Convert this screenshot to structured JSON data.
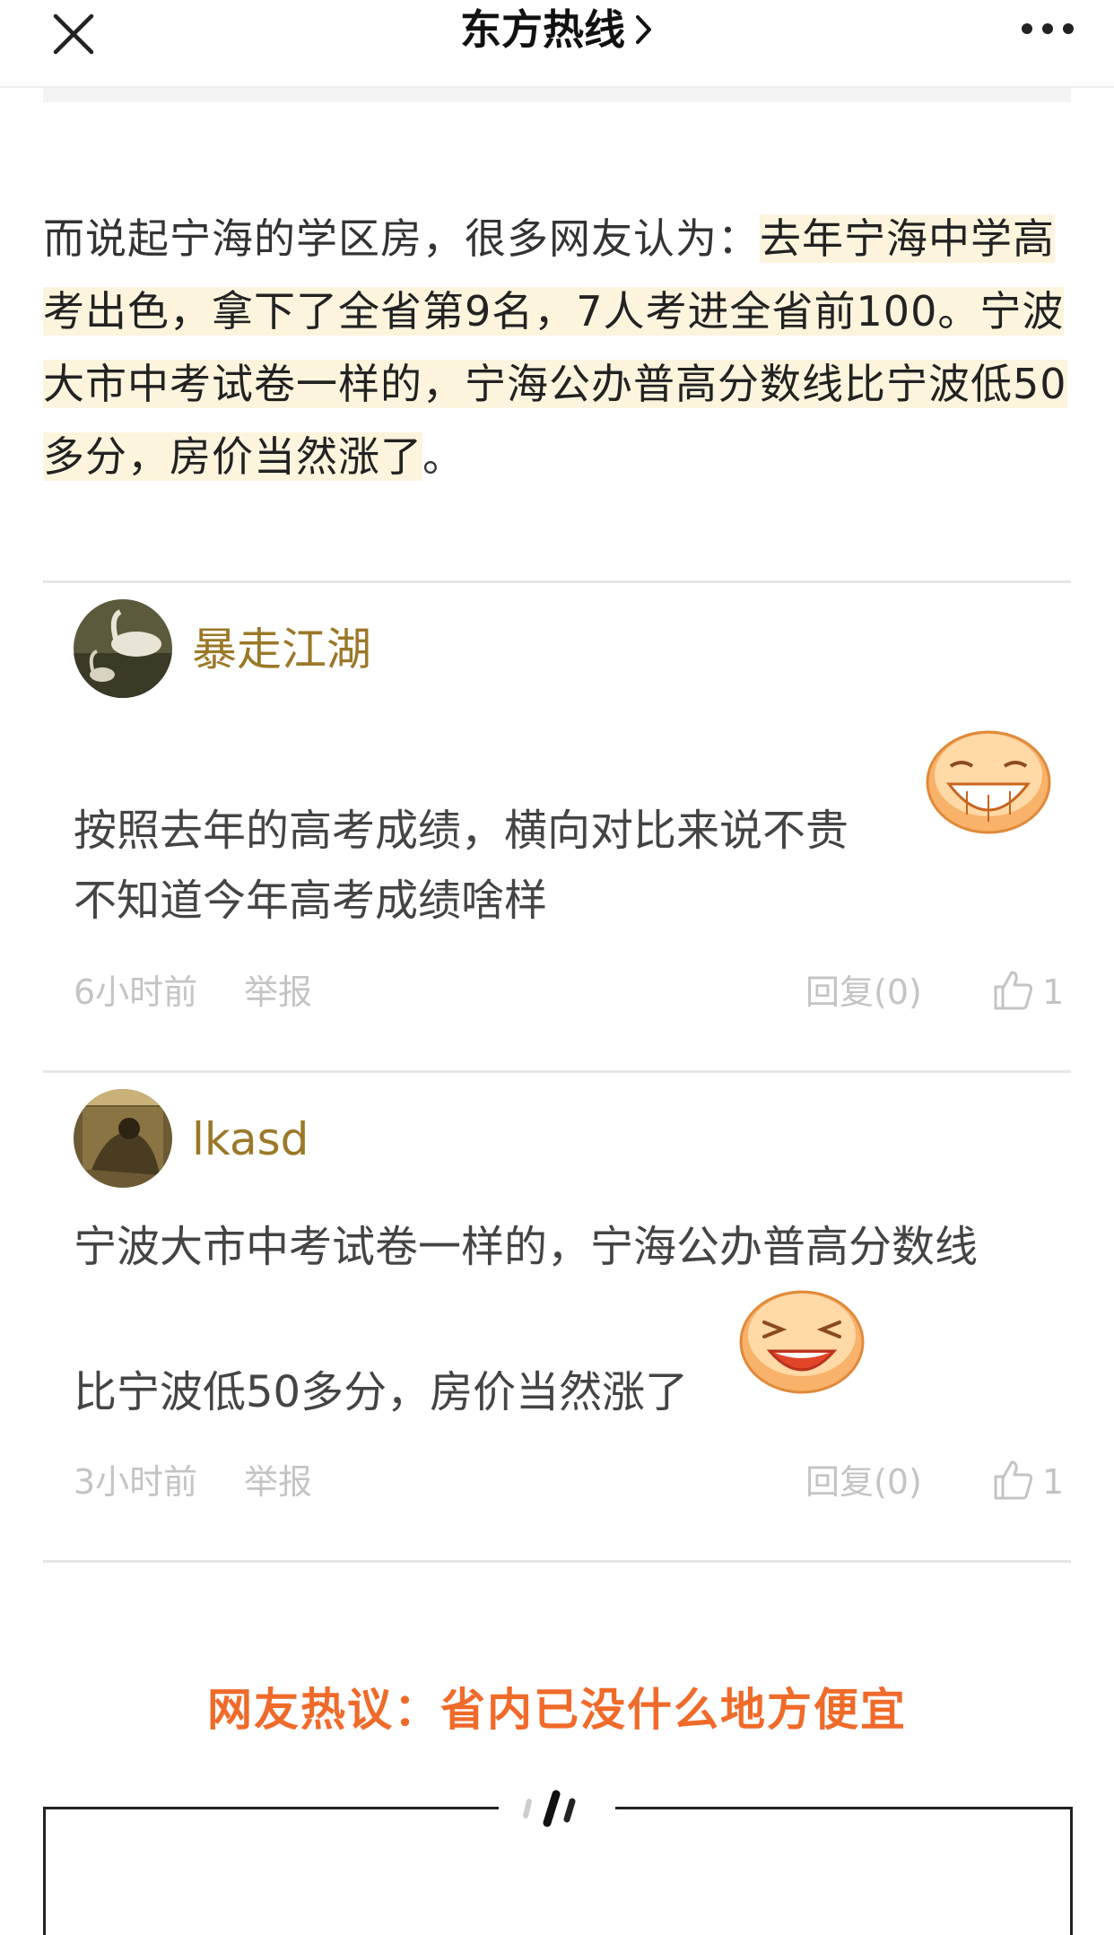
{
  "header": {
    "title": "东方热线",
    "close_icon": "close-icon",
    "more_icon": "more-dots-icon",
    "chevron_icon": "chevron-right-icon"
  },
  "article": {
    "lead": "而说起宁海的学区房，很多网友认为：",
    "highlight_1": "去年宁海中学高考出色，拿下了全省第9名，7人考进全省前100。宁波大市中考试卷一样的，宁海公办普高分数线比宁波低50多分，房价当然涨了",
    "tail": "。"
  },
  "comments": [
    {
      "username": "暴走江湖",
      "line_1": "按照去年的高考成绩，横向对比来说不贵",
      "line_2": "不知道今年高考成绩啥样",
      "time": "6小时前",
      "report": "举报",
      "reply": "回复(0)",
      "likes": "1",
      "emoji": "grin-emoji"
    },
    {
      "username": "lkasd",
      "line_1": "宁波大市中考试卷一样的，宁海公办普高分数线",
      "line_2": "比宁波低50多分，房价当然涨了",
      "time": "3小时前",
      "report": "举报",
      "reply": "回复(0)",
      "likes": "1",
      "emoji": "laughing-emoji"
    }
  ],
  "section": {
    "hot_title": "网友热议：省内已没什么地方便宜"
  },
  "colors": {
    "highlight_bg": "#fdf4dd",
    "username": "#9b7828",
    "hot_title": "#f06a2a",
    "meta": "#c4c4c4"
  }
}
